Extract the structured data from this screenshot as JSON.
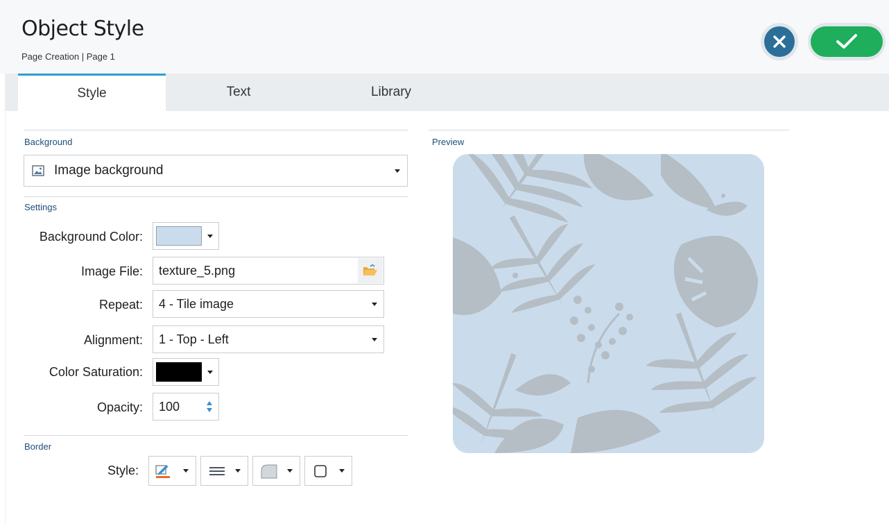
{
  "header": {
    "title": "Object Style",
    "subtitle": "Page Creation | Page 1",
    "cancel_icon": "close-icon",
    "confirm_icon": "checkmark-icon"
  },
  "tabs": [
    {
      "label": "Style",
      "active": true
    },
    {
      "label": "Text",
      "active": false
    },
    {
      "label": "Library",
      "active": false
    }
  ],
  "background": {
    "section_label": "Background",
    "type_icon": "image-icon",
    "type_value": "Image background"
  },
  "settings": {
    "section_label": "Settings",
    "background_color_label": "Background Color:",
    "background_color_value": "#cadcec",
    "image_file_label": "Image File:",
    "image_file_value": "texture_5.png",
    "image_file_icon": "folder-open-icon",
    "repeat_label": "Repeat:",
    "repeat_value": "4 - Tile image",
    "alignment_label": "Alignment:",
    "alignment_value": "1 - Top - Left",
    "color_saturation_label": "Color Saturation:",
    "color_saturation_value": "#000000",
    "opacity_label": "Opacity:",
    "opacity_value": "100"
  },
  "border": {
    "section_label": "Border",
    "style_label": "Style:",
    "buttons": [
      {
        "icon": "pen-color-icon"
      },
      {
        "icon": "line-width-icon"
      },
      {
        "icon": "corner-radius-icon"
      },
      {
        "icon": "border-shape-icon"
      }
    ]
  },
  "preview": {
    "section_label": "Preview",
    "background_color": "#cadcec",
    "foliage_color": "#b4bcc4"
  },
  "colors": {
    "accent": "#2f9ecf",
    "cancel": "#2b6f98",
    "confirm": "#1fae5b",
    "section_label": "#1f4e79"
  }
}
